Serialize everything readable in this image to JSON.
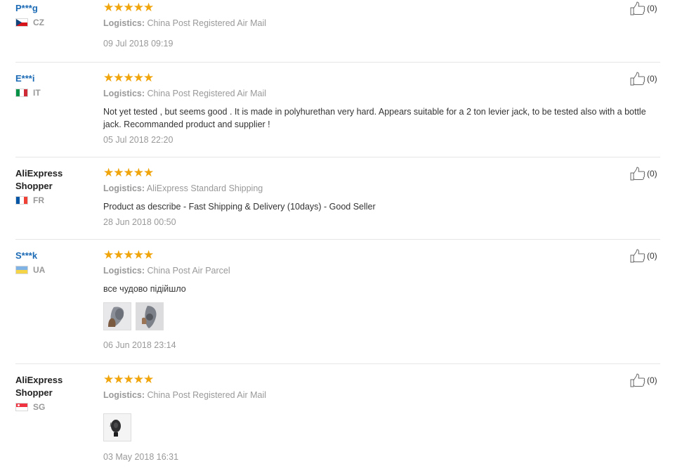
{
  "logistics_label": "Logistics:",
  "reviews": [
    {
      "user": "P***g",
      "country": "CZ",
      "rating": 5,
      "logistics": "China Post Registered Air Mail",
      "comment": "",
      "date": "09 Jul 2018 09:19",
      "helpful": "(0)"
    },
    {
      "user": "E***i",
      "country": "IT",
      "rating": 5,
      "logistics": "China Post Registered Air Mail",
      "comment": "Not yet tested , but seems good . It is made in polyhurethan very hard. Appears suitable for a 2 ton levier jack, to be tested also with a bottle jack. Recommanded product and supplier !",
      "date": "05 Jul 2018 22:20",
      "helpful": "(0)"
    },
    {
      "user": "AliExpress Shopper",
      "country": "FR",
      "rating": 5,
      "logistics": "AliExpress Standard Shipping",
      "comment": "Product as describe - Fast Shipping & Delivery (10days) - Good Seller",
      "date": "28 Jun 2018 00:50",
      "helpful": "(0)"
    },
    {
      "user": "S***k",
      "country": "UA",
      "rating": 5,
      "logistics": "China Post Air Parcel",
      "comment": "все чудово підійшло",
      "date": "06 Jun 2018 23:14",
      "helpful": "(0)"
    },
    {
      "user": "AliExpress Shopper",
      "country": "SG",
      "rating": 5,
      "logistics": "China Post Registered Air Mail",
      "comment": "",
      "date": "03 May 2018 16:31",
      "helpful": "(0)"
    }
  ],
  "colors": {
    "star": "#f0a50c",
    "masked_user": "#1b6ab5",
    "meta_gray": "#999999",
    "divider": "#e6e6e6"
  },
  "icons": [
    "star-icon",
    "thumbs-up-icon",
    "flag-icon",
    "review-photo-thumbnail"
  ]
}
